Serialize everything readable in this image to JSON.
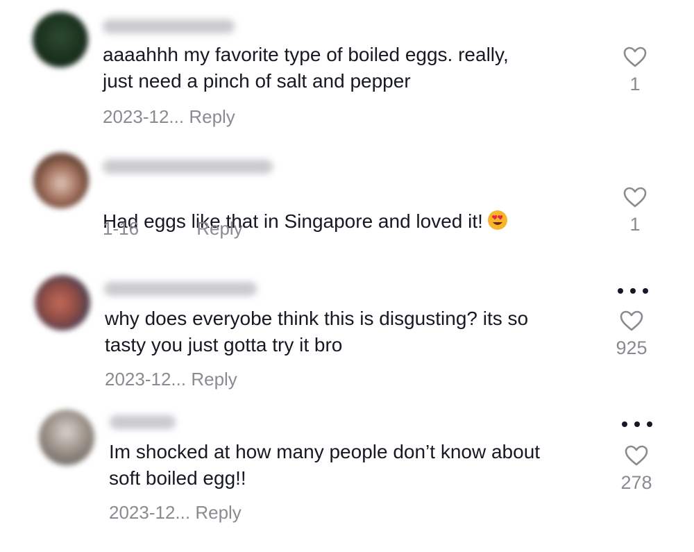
{
  "comments": [
    {
      "text": "aaaahhh my favorite type of boiled eggs. really,\njust need a pinch of salt and pepper",
      "date": "2023-12...",
      "reply": "Reply",
      "likes": "1",
      "avatar_color": "#1f3a24"
    },
    {
      "text": "Had eggs like that in Singapore and loved it!",
      "emoji": "heart-eyes-emoji",
      "date": "1-16",
      "reply": "Reply",
      "likes": "1",
      "avatar_color": "#7a5a4a"
    },
    {
      "text": "why does everyobe think this is disgusting? its so\ntasty you just gotta try it bro",
      "date": "2023-12...",
      "reply": "Reply",
      "likes": "925",
      "avatar_color": "#6f4f4a"
    },
    {
      "text": "Im shocked at how many people don’t know about\nsoft boiled egg!!",
      "date": "2023-12...",
      "reply": "Reply",
      "likes": "278",
      "avatar_color": "#a9a6a2"
    }
  ],
  "colors": {
    "text": "#161823",
    "muted": "#8a8b91",
    "like_outline": "#8a8b91"
  }
}
